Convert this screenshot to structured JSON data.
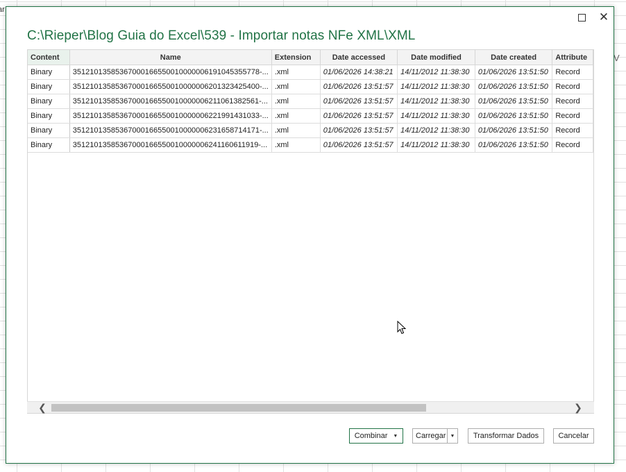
{
  "window": {
    "title": "C:\\Rieper\\Blog Guia do Excel\\539 - Importar notas NFe XML\\XML",
    "maximize_icon": "maximize-icon",
    "close_icon": "close-icon",
    "close_glyph": "✕"
  },
  "background": {
    "edge_text": "ar",
    "edge_text_right": "V"
  },
  "table": {
    "columns": [
      "Content",
      "Name",
      "Extension",
      "Date accessed",
      "Date modified",
      "Date created",
      "Attribute"
    ],
    "rows": [
      [
        "Binary",
        "35121013585367000166550010000006191045355778-...",
        ".xml",
        "01/06/2026 14:38:21",
        "14/11/2012 11:38:30",
        "01/06/2026 13:51:50",
        "Record"
      ],
      [
        "Binary",
        "35121013585367000166550010000006201323425400-...",
        ".xml",
        "01/06/2026 13:51:57",
        "14/11/2012 11:38:30",
        "01/06/2026 13:51:50",
        "Record"
      ],
      [
        "Binary",
        "35121013585367000166550010000006211061382561-...",
        ".xml",
        "01/06/2026 13:51:57",
        "14/11/2012 11:38:30",
        "01/06/2026 13:51:50",
        "Record"
      ],
      [
        "Binary",
        "35121013585367000166550010000006221991431033-...",
        ".xml",
        "01/06/2026 13:51:57",
        "14/11/2012 11:38:30",
        "01/06/2026 13:51:50",
        "Record"
      ],
      [
        "Binary",
        "35121013585367000166550010000006231658714171-...",
        ".xml",
        "01/06/2026 13:51:57",
        "14/11/2012 11:38:30",
        "01/06/2026 13:51:50",
        "Record"
      ],
      [
        "Binary",
        "35121013585367000166550010000006241160611919-...",
        ".xml",
        "01/06/2026 13:51:57",
        "14/11/2012 11:38:30",
        "01/06/2026 13:51:50",
        "Record"
      ]
    ]
  },
  "scrollbar": {
    "left_glyph": "❮",
    "right_glyph": "❯"
  },
  "buttons": {
    "combine": "Combinar",
    "load": "Carregar",
    "transform": "Transformar Dados",
    "cancel": "Cancelar",
    "caret_glyph": "▼"
  },
  "colors": {
    "accent": "#217346",
    "header_bg": "#f3f3f3"
  }
}
